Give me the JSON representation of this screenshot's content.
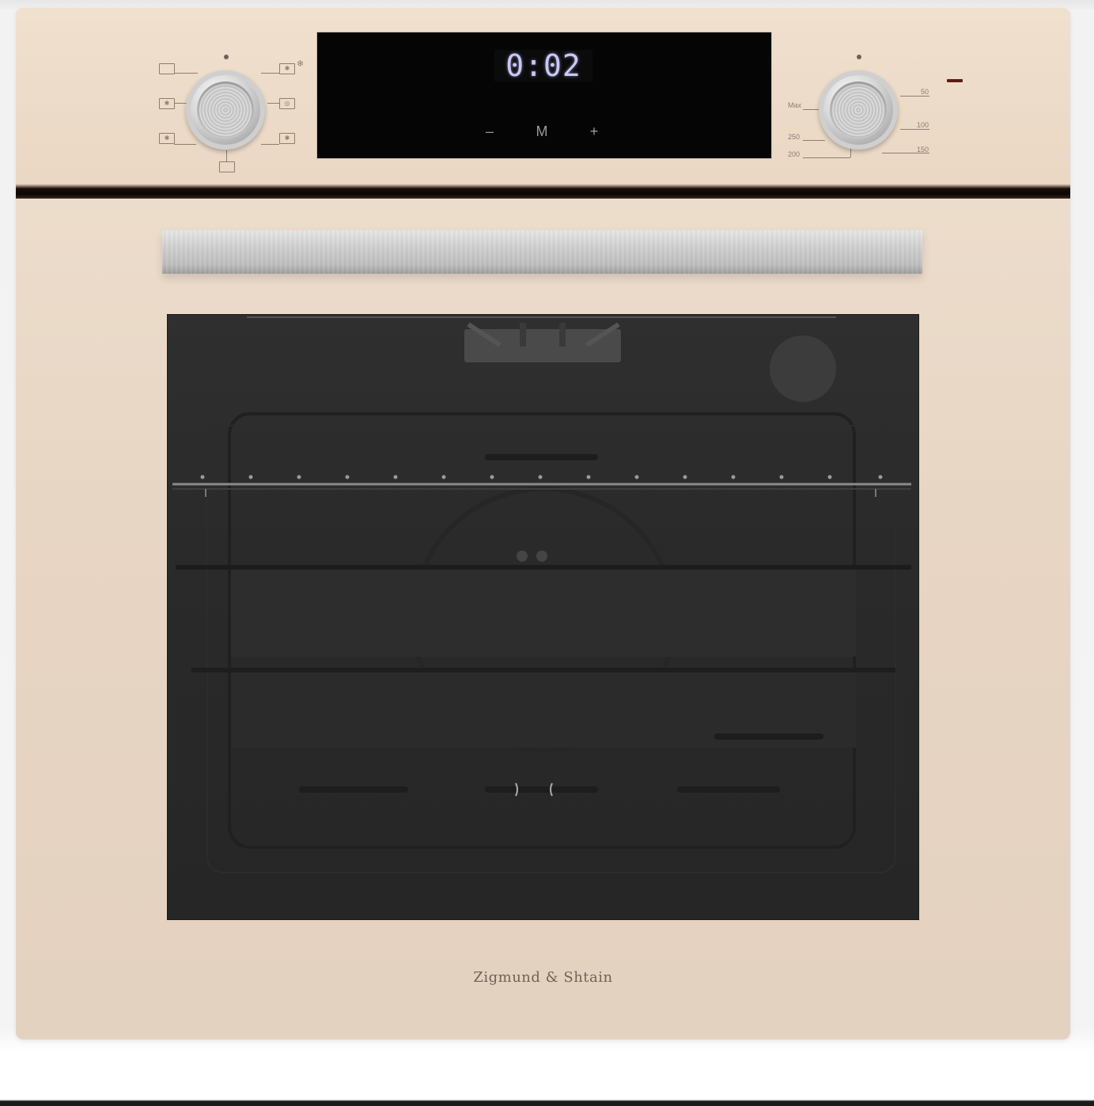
{
  "product": {
    "brand": "Zigmund & Shtain",
    "colors": {
      "body": "#e8d6c5",
      "display_bg": "#050505",
      "display_text": "#c9c8f2",
      "knob": "#cfcfcf",
      "handle": "#c8c8c8",
      "window": "#2a2a2a"
    }
  },
  "display": {
    "time": "0:02",
    "minus_label": "–",
    "mode_label": "M",
    "plus_label": "+"
  },
  "temperature_dial": {
    "labels": [
      "Max",
      "250",
      "200",
      "150",
      "100",
      "50"
    ]
  },
  "mode_dial": {
    "icons": [
      "top-heat-icon",
      "fan-icon",
      "bottom-heat-fan-icon",
      "defrost-icon",
      "convection-fan-icon",
      "grill-icon",
      "light-icon"
    ]
  }
}
